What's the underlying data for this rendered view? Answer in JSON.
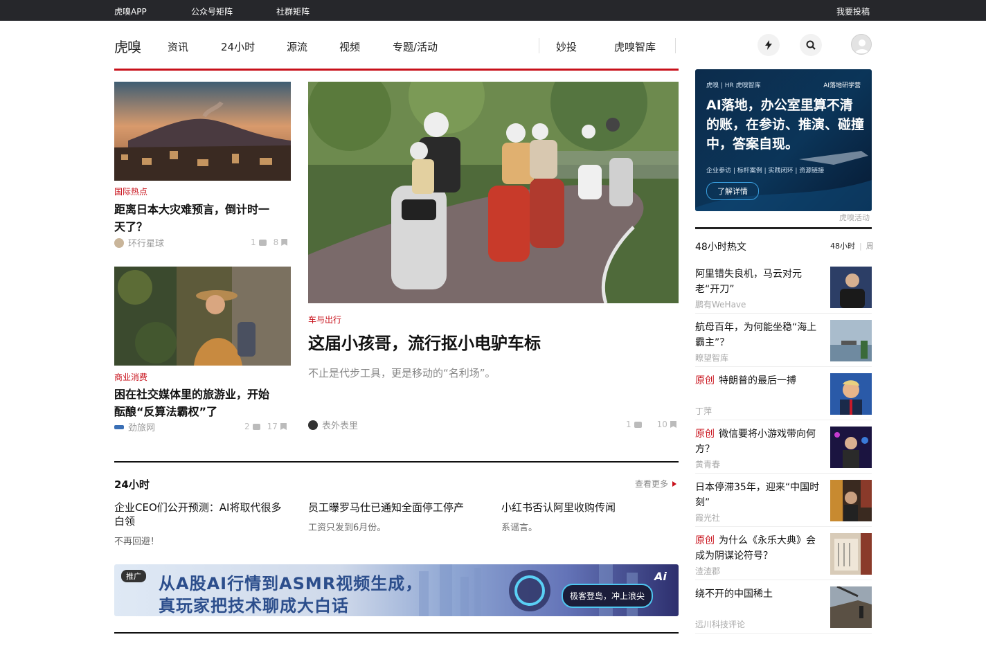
{
  "topbar": {
    "left_links": [
      "虎嗅APP",
      "公众号矩阵",
      "社群矩阵"
    ],
    "right_link": "我要投稿"
  },
  "nav": {
    "logo": "虎嗅",
    "items": [
      "资讯",
      "24小时",
      "源流",
      "视频",
      "专题/活动"
    ],
    "right_items": [
      "妙投",
      "虎嗅智库"
    ]
  },
  "cards": {
    "left_top": {
      "tag": "国际热点",
      "title": "距离日本大灾难预言，倒计时一天了？",
      "title_l1": "距离日本大灾难预言，倒计时一",
      "title_l2": "天了？",
      "author": "环行星球",
      "comments": "1",
      "saves": "8"
    },
    "left_bottom": {
      "tag": "商业消费",
      "title_l1": "困在社交媒体里的旅游业，开始",
      "title_l2": "酝酿“反算法霸权”了",
      "author": "劲旅网",
      "comments": "2",
      "saves": "17"
    },
    "main": {
      "tag": "车与出行",
      "title": "这届小孩哥，流行抠小电驴车标",
      "summary": "不止是代步工具，更是移动的“名利场”。",
      "author": "表外表里",
      "comments": "1",
      "saves": "10"
    }
  },
  "section_24h": {
    "title": "24小时",
    "more": "查看更多",
    "items": [
      {
        "title_l1": "企业CEO们公开预测：AI将取代很多",
        "title_l2": "白领",
        "sub": "不再回避！"
      },
      {
        "title_l1": "员工曝罗马仕已通知全面停工停产",
        "title_l2": "",
        "sub": "工资只发到6月份。"
      },
      {
        "title_l1": "小红书否认阿里收购传闻",
        "title_l2": "",
        "sub": "系谣言。"
      }
    ]
  },
  "promo": {
    "ad_tag": "推广",
    "line1": "从A股AI行情到ASMR视频生成，",
    "line2": "真玩家把技术聊成大白话",
    "pill": "极客登岛，冲上浪尖",
    "corner": "Ai"
  },
  "right_ad": {
    "header_left": "虎嗅 | HR 虎嗅智库",
    "header_right": "AI落地研学营",
    "headline": "AI落地，办公室里算不清的账，在参访、推演、碰撞中，答案自现。",
    "subline": "企业参访 | 标杆案例 | 实践闭环 | 资源链接",
    "button": "了解详情",
    "caption": "虎嗅活动"
  },
  "hot": {
    "title": "48小时热文",
    "tab_active": "48小时",
    "tab_other": "周",
    "original_label": "原创",
    "items": [
      {
        "title": "阿里错失良机，马云对元老“开刀”",
        "source": "鹏有WeHave",
        "original": false
      },
      {
        "title": "航母百年，为何能坐稳“海上霸主”？",
        "source": "瞭望智库",
        "original": false
      },
      {
        "title": "特朗普的最后一搏",
        "source": "丁萍",
        "original": true
      },
      {
        "title": "微信要将小游戏带向何方？",
        "source": "黄青春",
        "original": true
      },
      {
        "title": "日本停滞35年，迎来“中国时刻”",
        "source": "霞光社",
        "original": false
      },
      {
        "title": "为什么《永乐大典》会成为阴谋论符号？",
        "source": "渣渣郡",
        "original": true
      },
      {
        "title": "绕不开的中国稀土",
        "source": "远川科技评论",
        "original": false
      }
    ]
  }
}
